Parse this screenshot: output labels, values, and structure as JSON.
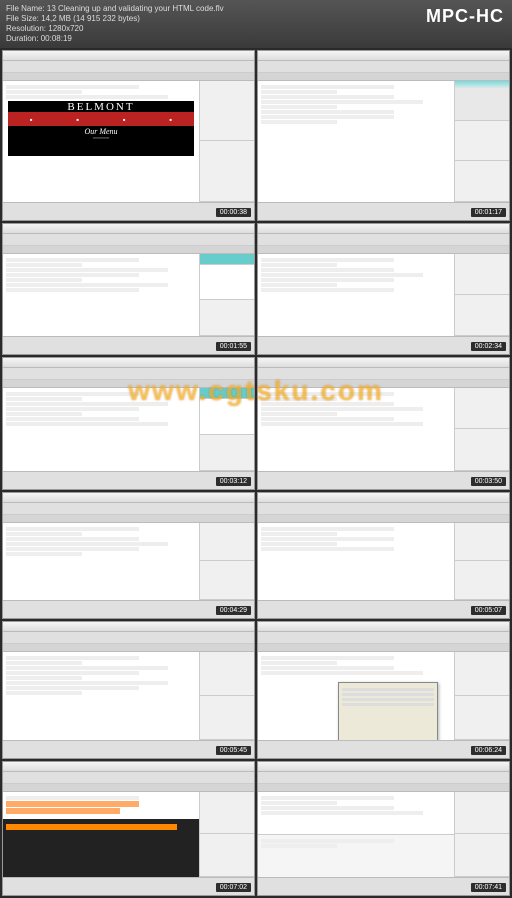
{
  "player": {
    "brand": "MPC-HC",
    "file_name_label": "File Name:",
    "file_name": "13 Cleaning up and validating your HTML code.flv",
    "file_size_label": "File Size:",
    "file_size": "14,2 MB (14 915 232 bytes)",
    "resolution_label": "Resolution:",
    "resolution": "1280x720",
    "duration_label": "Duration:",
    "duration": "00:08:19"
  },
  "watermark": "www.cgtsku.com",
  "thumbnails": [
    {
      "timestamp": "00:00:38",
      "preview": {
        "title": "BELMONT",
        "menu_heading": "Our Menu"
      }
    },
    {
      "timestamp": "00:01:17"
    },
    {
      "timestamp": "00:01:55"
    },
    {
      "timestamp": "00:02:34"
    },
    {
      "timestamp": "00:03:12"
    },
    {
      "timestamp": "00:03:50"
    },
    {
      "timestamp": "00:04:29"
    },
    {
      "timestamp": "00:05:07"
    },
    {
      "timestamp": "00:05:45"
    },
    {
      "timestamp": "00:06:24"
    },
    {
      "timestamp": "00:07:02"
    },
    {
      "timestamp": "00:07:41"
    }
  ]
}
